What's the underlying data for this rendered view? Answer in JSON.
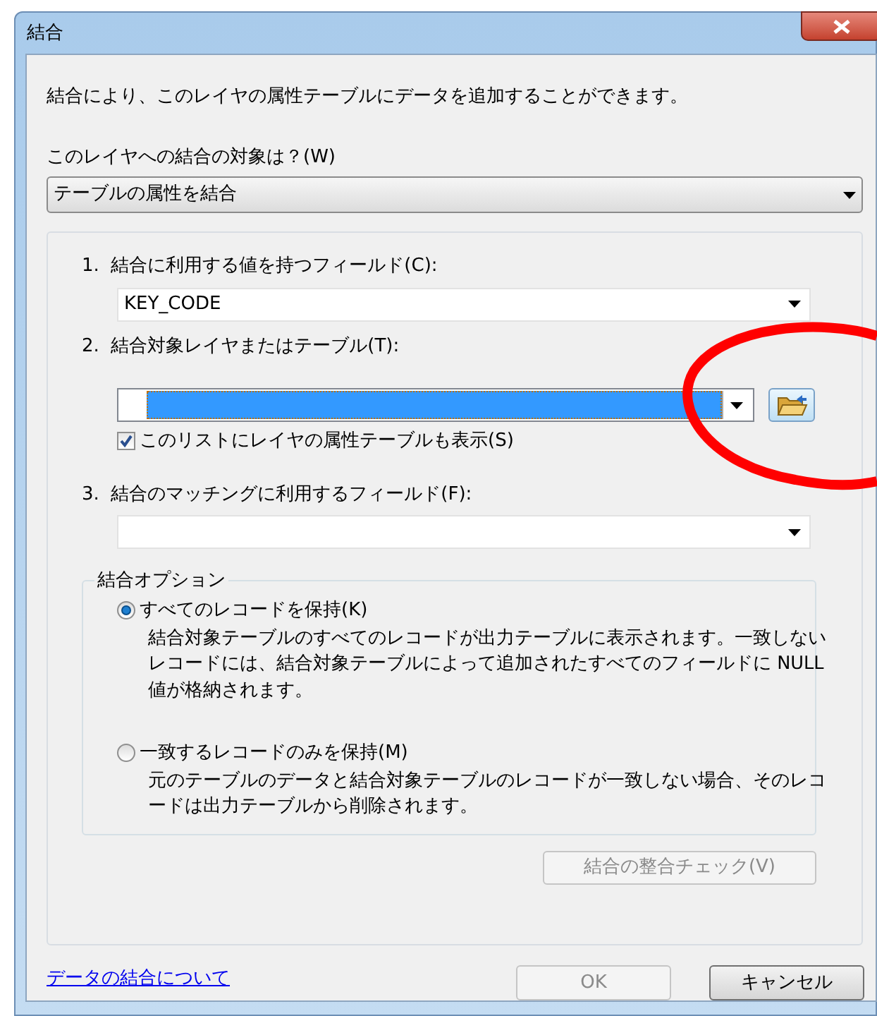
{
  "window": {
    "title": "結合"
  },
  "description": "結合により、このレイヤの属性テーブルにデータを追加することができます。",
  "target": {
    "label": "このレイヤへの結合の対象は？(W)",
    "value": "テーブルの属性を結合"
  },
  "steps": [
    {
      "number": "1.",
      "label": "結合に利用する値を持つフィールド(C):",
      "kind": "combo",
      "value": "KEY_CODE"
    },
    {
      "number": "2.",
      "label": "結合対象レイヤまたはテーブル(T):",
      "kind": "combo_browse",
      "highlighted": true,
      "checkbox": {
        "label": "このリストにレイヤの属性テーブルも表示(S)",
        "checked": true
      }
    },
    {
      "number": "3.",
      "label": "結合のマッチングに利用するフィールド(F):",
      "kind": "combo"
    }
  ],
  "options": {
    "title": "結合オプション",
    "items": [
      {
        "label": "すべてのレコードを保持(K)",
        "description": "結合対象テーブルのすべてのレコードが出力テーブルに表示されます。一致しないレコードには、結合対象テーブルによって追加されたすべてのフィールドに NULL 値が格納されます。",
        "selected": true
      },
      {
        "label": "一致するレコードのみを保持(M)",
        "description": "元のテーブルのデータと結合対象テーブルのレコードが一致しない場合、そのレコードは出力テーブルから削除されます。",
        "selected": false
      }
    ]
  },
  "validate_button": {
    "label": "結合の整合チェック(V)",
    "disabled": true
  },
  "help_link": "データの結合について",
  "buttons": [
    {
      "label": "OK",
      "disabled": true
    },
    {
      "label": "キャンセル",
      "disabled": false
    }
  ],
  "annotations": [
    {
      "kind": "ellipse"
    }
  ]
}
